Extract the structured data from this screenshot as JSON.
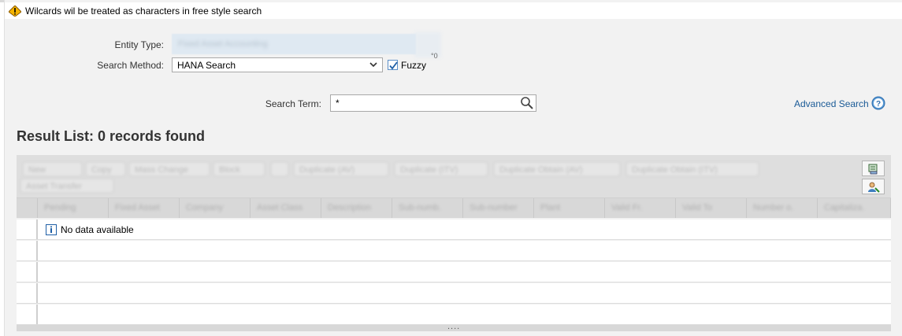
{
  "message": {
    "text": "Wilcards wil be treated as characters in free style search"
  },
  "form": {
    "entity_type_label": "Entity Type:",
    "entity_type_value": "Fixed Asset Accounting",
    "search_method_label": "Search Method:",
    "search_method_value": "HANA Search",
    "fuzzy_label": "Fuzzy",
    "fuzzy_checked": true,
    "search_term_label": "Search Term:",
    "search_term_value": "*",
    "advanced_search": "Advanced Search"
  },
  "results": {
    "title": "Result List: 0 records found",
    "no_data": "No data available",
    "toolbar": [
      "New",
      "Copy",
      "Mass Change",
      "Block",
      "Duplicate (AV)",
      "Duplicate (ITV)",
      "Duplicate Obtain (AV)",
      "Duplicate Obtain (ITV)",
      "Asset Transfer"
    ],
    "columns": [
      "Pending",
      "Fixed Asset",
      "Company",
      "Asset Class",
      "Description",
      "Sub-numb.",
      "Sub-number",
      "Plant",
      "Valid Fr.",
      "Valid To",
      "Number o.",
      "Capitaliza."
    ]
  },
  "colors": {
    "link": "#1a5a96",
    "warning": "#f0a400",
    "info": "#1f5fa6"
  }
}
